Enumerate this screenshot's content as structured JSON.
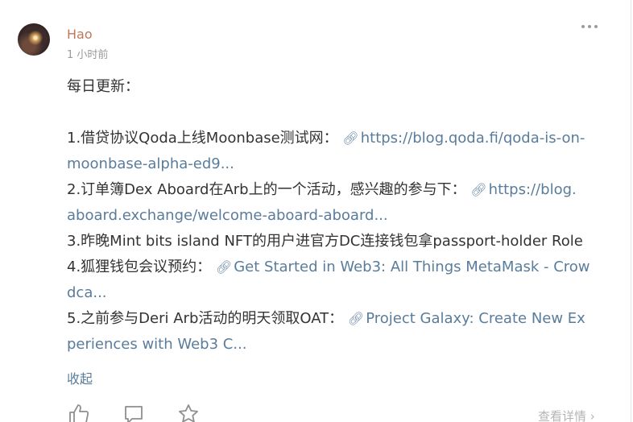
{
  "post": {
    "author": "Hao",
    "time": "1 小时前",
    "heading": "每日更新：",
    "items": [
      {
        "prefix": "1.借贷协议Qoda上线Moonbase测试网：",
        "link_line1": "https://blog.qoda.fi/qoda-is-on-",
        "link_line2": "moonbase-alpha-ed9..."
      },
      {
        "prefix": "2.订单簿Dex Aboard在Arb上的一个活动，感兴趣的参与下：",
        "link_line1": "https://blog.",
        "link_line2": "aboard.exchange/welcome-aboard-aboard..."
      },
      {
        "text": "3.昨晚Mint bits island NFT的用户进官方DC连接钱包拿passport-holder Role"
      },
      {
        "prefix": "4.狐狸钱包会议预约：",
        "link_line1": "Get Started in Web3: All Things MetaMask - Crow",
        "link_line2": "dca..."
      },
      {
        "prefix": "5.之前参与Deri Arb活动的明天领取OAT：",
        "link_line1": "Project Galaxy: Create New Ex",
        "link_line2": "periences with Web3 C..."
      }
    ],
    "collapse_label": "收起",
    "detail_label": "查看详情"
  },
  "icons": {
    "more": "more-dots-icon",
    "link": "link-icon",
    "like": "thumbs-up-icon",
    "comment": "comment-icon",
    "favorite": "star-icon",
    "chevron": "chevron-right-icon"
  },
  "colors": {
    "author": "#c0785a",
    "link": "#5a7c9b",
    "text": "#333333",
    "muted": "#9a9a9a"
  }
}
